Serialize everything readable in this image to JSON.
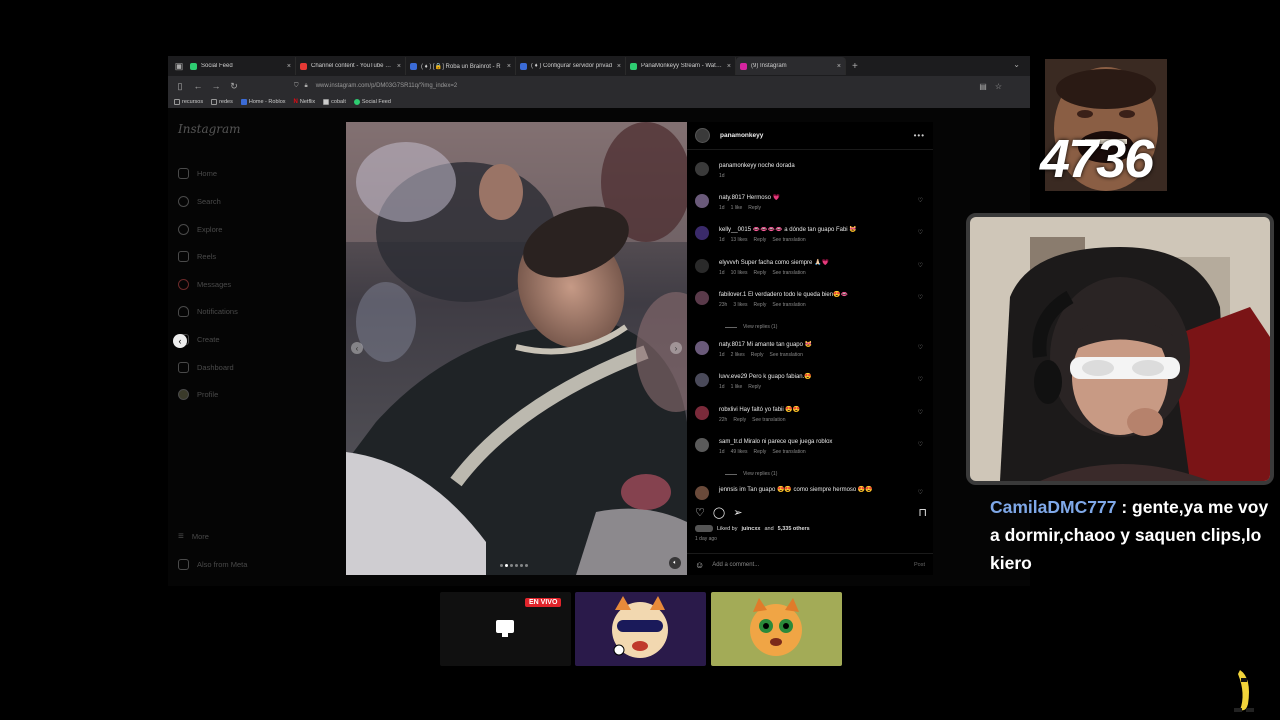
{
  "browser": {
    "tabs": [
      {
        "label": "Social Feed",
        "color": "#2ecc71",
        "active": false
      },
      {
        "label": "Channel content - YouTube Stu",
        "color": "#e53935",
        "active": false
      },
      {
        "label": "( ♦ ) [🔒] Roba un Brainrot - R",
        "color": "#3b6bd6",
        "active": false
      },
      {
        "label": "( ♦ ) Configurar servidor privad",
        "color": "#3b6bd6",
        "active": false
      },
      {
        "label": "PanaMonkeyy Stream - Watch L",
        "color": "#2ecc71",
        "active": false
      },
      {
        "label": "(9) Instagram",
        "color": "#d6249f",
        "active": true
      }
    ],
    "url": "www.instagram.com/p/DM03G7SR11q/?img_index=2",
    "bookmarks": [
      "recursos",
      "redes",
      "Home - Roblox",
      "Netflix",
      "cobalt",
      "Social Feed"
    ]
  },
  "instagram": {
    "logo": "Instagram",
    "sidebar": [
      "Home",
      "Search",
      "Explore",
      "Reels",
      "Messages",
      "Notifications",
      "Create",
      "Dashboard",
      "Profile"
    ],
    "sidebar_bottom": [
      "More",
      "Also from Meta"
    ],
    "post": {
      "author": "panamonkeyy",
      "caption_user": "panamonkeyy",
      "caption": "noche dorada",
      "caption_time": "1d",
      "comments": [
        {
          "user": "naty.8017",
          "text": "Hermoso 💗",
          "time": "1d",
          "likes": "1 like",
          "translate": ""
        },
        {
          "user": "kelly__0015",
          "text": "👄👄👄👄 a dónde tan guapo Fabi 😻",
          "time": "1d",
          "likes": "13 likes",
          "translate": "See translation"
        },
        {
          "user": "elyvvvh",
          "text": "Super facha como siempre 🙏🏻💗",
          "time": "1d",
          "likes": "10 likes",
          "translate": "See translation"
        },
        {
          "user": "fabilover.1",
          "text": "El verdadero todo le queda bien😍👄",
          "time": "23h",
          "likes": "3 likes",
          "translate": "See translation"
        },
        {
          "user": "naty.8017",
          "text": "Mi amante tan guapo 😻",
          "time": "1d",
          "likes": "2 likes",
          "translate": "See translation"
        },
        {
          "user": "luvv.eve29",
          "text": "Pero k guapo fabian.😍",
          "time": "1d",
          "likes": "1 like",
          "translate": ""
        },
        {
          "user": "robxlivi",
          "text": "Hay faltó yo fabii 😍😍",
          "time": "22h",
          "likes": "",
          "translate": "See translation"
        },
        {
          "user": "sam_tr.d",
          "text": "Miralo ni parece que juega roblox",
          "time": "1d",
          "likes": "49 likes",
          "translate": "See translation"
        },
        {
          "user": "jennsis",
          "text": "im Tan guapo 😍😍 como siempre hermoso 😍😍",
          "time": "",
          "likes": "",
          "translate": ""
        }
      ],
      "reply_label": "Reply",
      "view_replies": "View replies (1)",
      "liked_by_prefix": "Liked by",
      "liked_by_user": "juincxx",
      "liked_by_suffix": "and",
      "liked_by_count": "5,335 others",
      "posted": "1 day ago",
      "add_comment_placeholder": "Add a comment...",
      "post_button": "Post",
      "carousel_total": 6,
      "carousel_index": 2
    }
  },
  "stream": {
    "counter": "4736",
    "chat_user": "CamilaDMC777",
    "chat_text": "gente,ya me voy a dormir,chaoo y saquen clips,lo kiero",
    "live_badge": "EN VIVO",
    "colors": {
      "chat_user": "#7fa8e8",
      "live": "#e0242b"
    }
  }
}
